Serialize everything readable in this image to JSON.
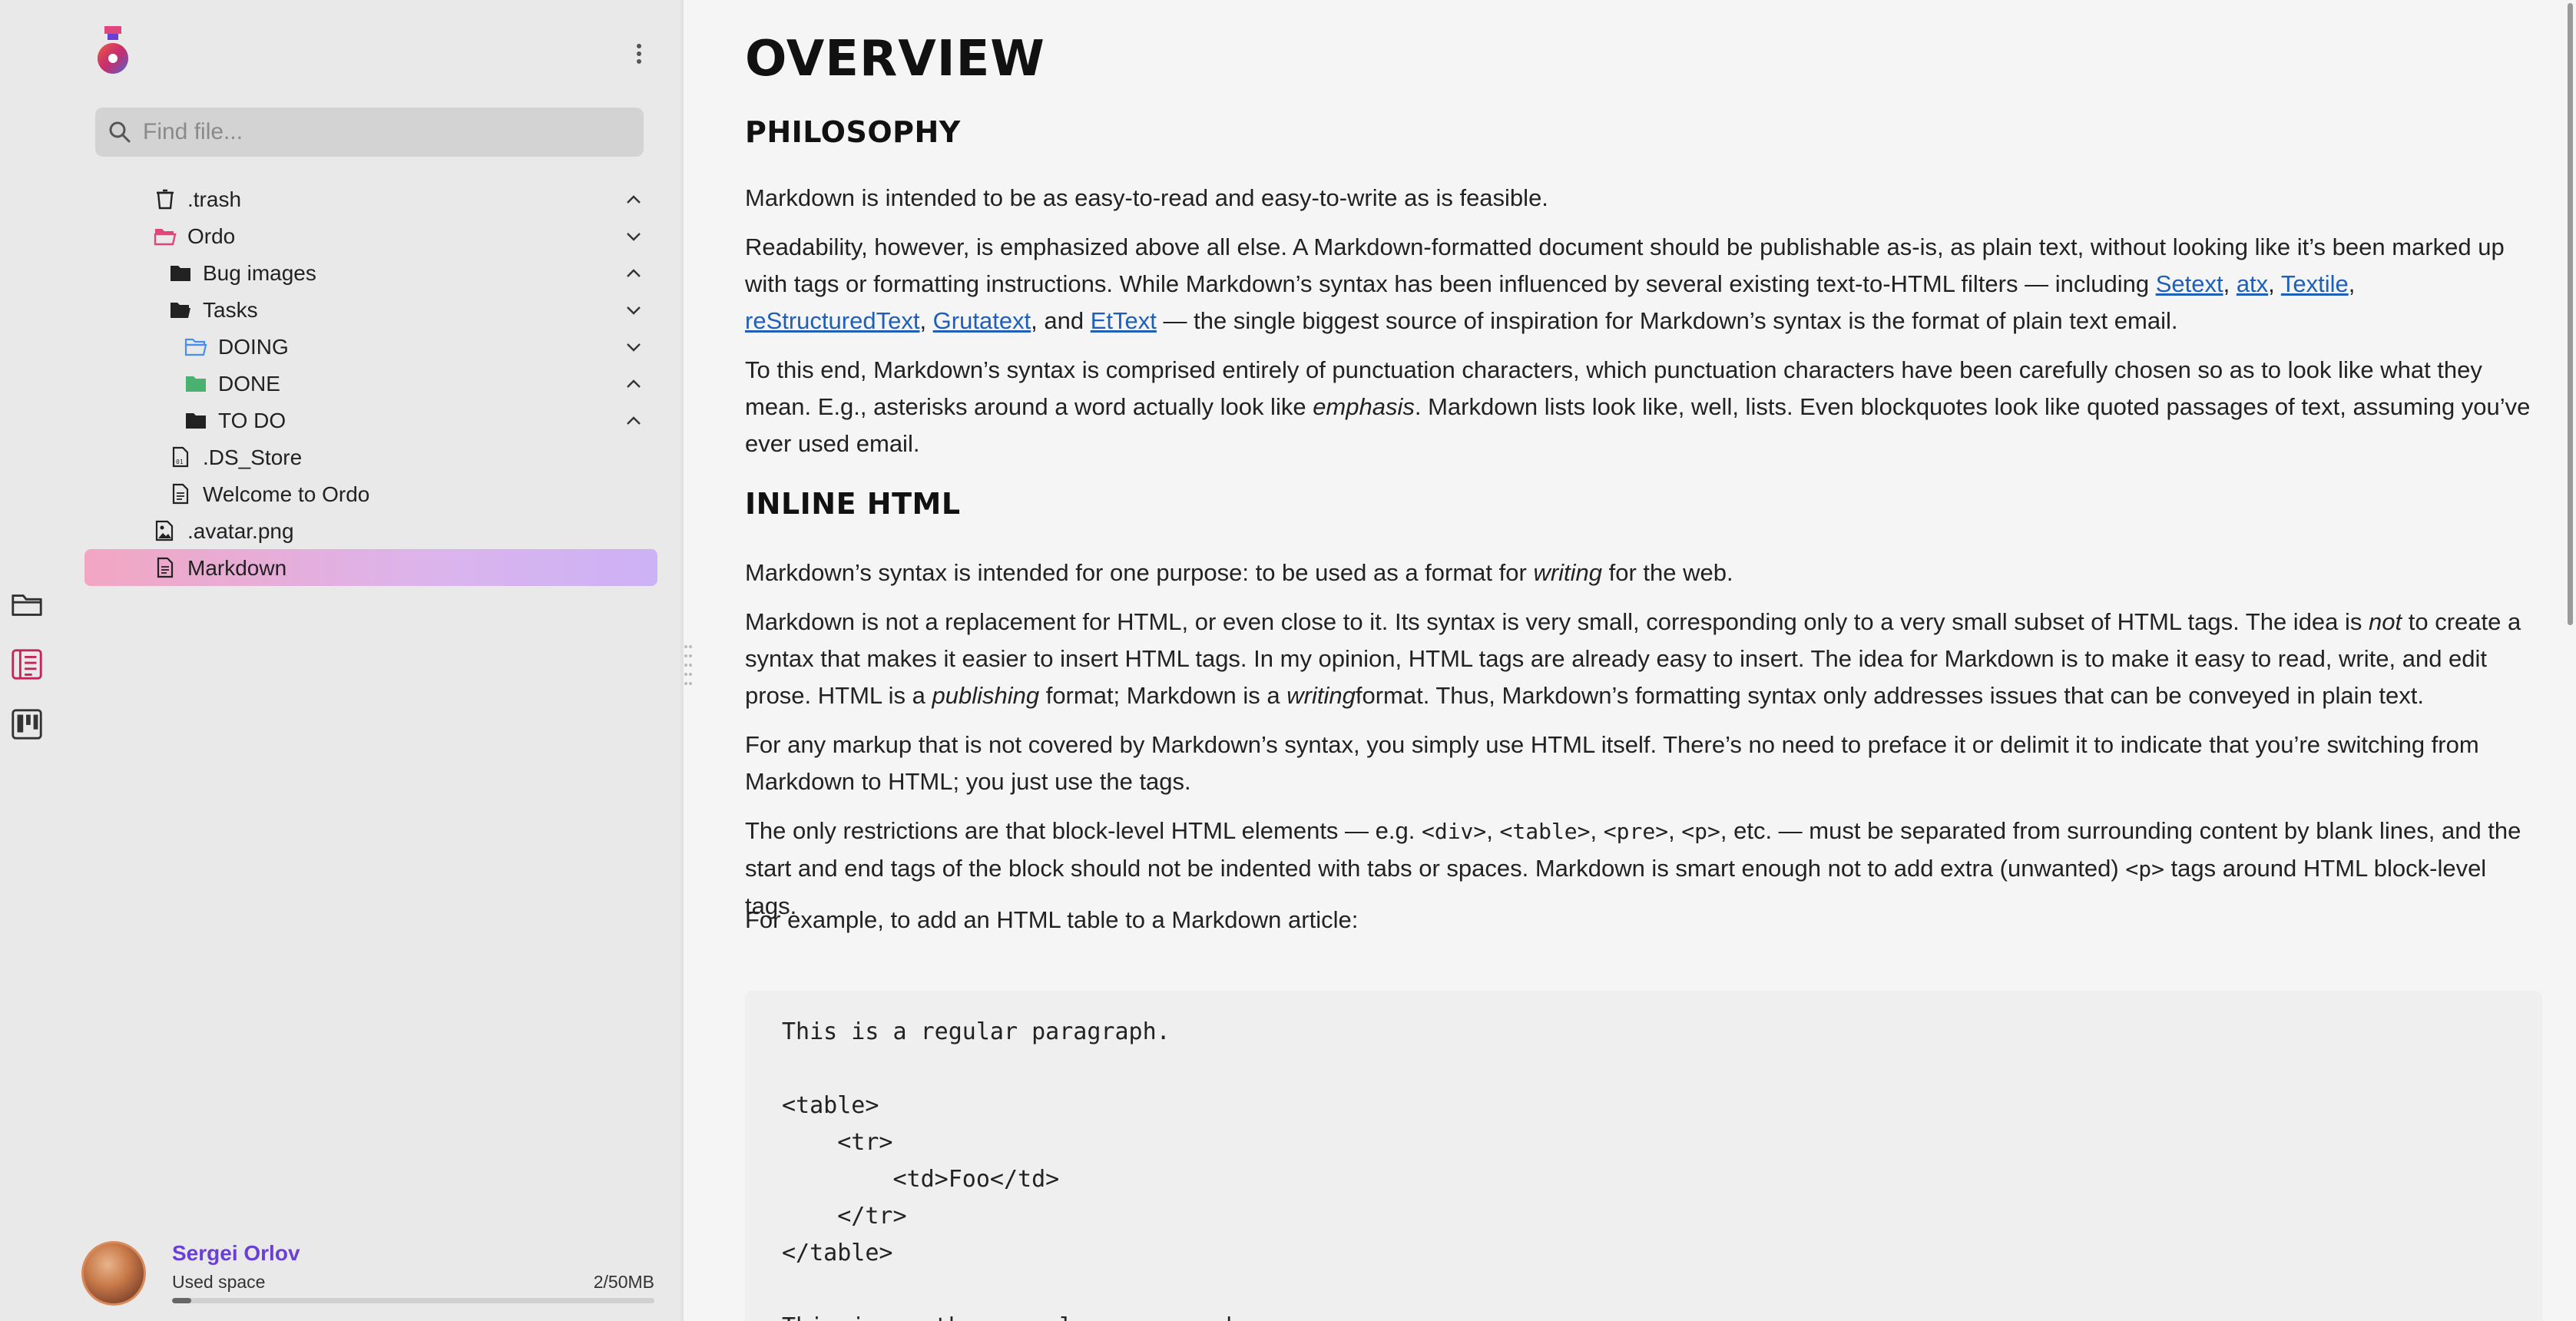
{
  "sidebar": {
    "search_placeholder": "Find file...",
    "tree": [
      {
        "label": ".trash",
        "icon": "trash-icon",
        "chevron": "up"
      },
      {
        "label": "Ordo",
        "icon": "folder-open-pink-icon",
        "chevron": "down"
      },
      {
        "label": "Bug images",
        "icon": "folder-icon",
        "chevron": "up"
      },
      {
        "label": "Tasks",
        "icon": "folder-open-icon",
        "chevron": "down"
      },
      {
        "label": "DOING",
        "icon": "folder-open-blue-icon",
        "chevron": "down"
      },
      {
        "label": "DONE",
        "icon": "folder-green-icon",
        "chevron": "up"
      },
      {
        "label": "TO DO",
        "icon": "folder-icon",
        "chevron": "up"
      },
      {
        "label": ".DS_Store",
        "icon": "binary-file-icon",
        "chevron": ""
      },
      {
        "label": "Welcome to Ordo",
        "icon": "document-icon",
        "chevron": ""
      },
      {
        "label": ".avatar.png",
        "icon": "image-file-icon",
        "chevron": ""
      },
      {
        "label": "Markdown",
        "icon": "document-icon",
        "chevron": "",
        "selected": true
      }
    ],
    "user": {
      "name": "Sergei Orlov",
      "used_label": "Used space",
      "used_value": "2/50MB",
      "used_fraction": 0.04
    }
  },
  "rail": {
    "items": [
      "folder-icon",
      "outline-icon",
      "kanban-icon"
    ]
  },
  "content": {
    "title": "OVERVIEW",
    "h_philosophy": "PHILOSOPHY",
    "p1": "Markdown is intended to be as easy-to-read and easy-to-write as is feasible.",
    "p2_a": "Readability, however, is emphasized above all else. A Markdown-formatted document should be publishable as-is, as plain text, without looking like it’s been marked up with tags or formatting instructions. While Markdown’s syntax has been influenced by several existing text-to-HTML filters — including ",
    "links": [
      "Setext",
      "atx",
      "Textile",
      "reStructuredText",
      "Grutatext",
      "EtText"
    ],
    "p2_b": " — the single biggest source of inspiration for Markdown’s syntax is the format of plain text email.",
    "p3_a": "To this end, Markdown’s syntax is comprised entirely of punctuation characters, which punctuation characters have been carefully chosen so as to look like what they mean. E.g., asterisks around a word actually look like ",
    "p3_em": "emphasis",
    "p3_b": ". Markdown lists look like, well, lists. Even blockquotes look like quoted passages of text, assuming you’ve ever used email.",
    "h_inline": "INLINE HTML",
    "p4_a": "Markdown’s syntax is intended for one purpose: to be used as a format for ",
    "p4_em": "writing",
    "p4_b": " for the web.",
    "p5_a": "Markdown is not a replacement for HTML, or even close to it. Its syntax is very small, corresponding only to a very small subset of HTML tags. The idea is ",
    "p5_em1": "not",
    "p5_b": " to create a syntax that makes it easier to insert HTML tags. In my opinion, HTML tags are already easy to insert. The idea for Markdown is to make it easy to read, write, and edit prose. HTML is a ",
    "p5_em2": "publishing",
    "p5_c": " format; Markdown is a ",
    "p5_em3": "writing",
    "p5_d": "format. Thus, Markdown’s formatting syntax only addresses issues that can be conveyed in plain text.",
    "p6": "For any markup that is not covered by Markdown’s syntax, you simply use HTML itself. There’s no need to preface it or delimit it to indicate that you’re switching from Markdown to HTML; you just use the tags.",
    "p7_a": "The only restrictions are that block-level HTML elements — e.g. ",
    "p7_tags": [
      "<div>",
      "<table>",
      "<pre>",
      "<p>"
    ],
    "p7_b": ", etc. — must be separated from surrounding content by blank lines, and the start and end tags of the block should not be indented with tabs or spaces. Markdown is smart enough not to add extra (unwanted) ",
    "p7_tag2": "<p>",
    "p7_c": " tags around HTML block-level tags.",
    "p8": "For example, to add an HTML table to a Markdown article:",
    "code": "This is a regular paragraph.\n\n<table>\n    <tr>\n        <td>Foo</td>\n    </tr>\n</table>\n\nThis is another regular paragraph."
  },
  "colors": {
    "accent_purple": "#6a3fd6",
    "link_blue": "#1f5fb8",
    "folder_pink": "#e0457b",
    "folder_blue": "#4a8fe7",
    "folder_green": "#49b26f"
  }
}
